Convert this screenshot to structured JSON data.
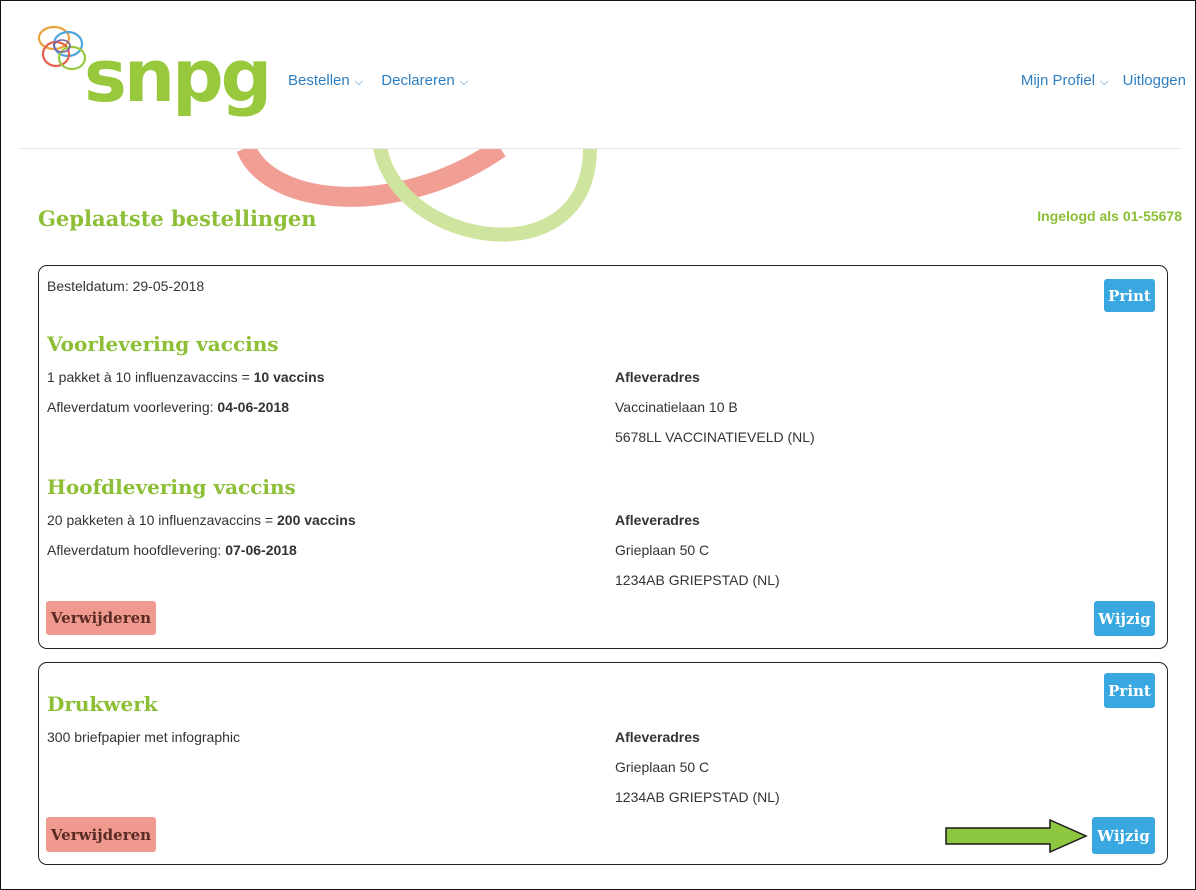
{
  "brand": {
    "logo_text": "snpg",
    "green": "#98c93c",
    "blue": "#3aa8e0",
    "red": "#f09a8f"
  },
  "nav": {
    "left": [
      {
        "label": "Bestellen"
      },
      {
        "label": "Declareren"
      }
    ],
    "right": [
      {
        "label": "Mijn Profiel"
      },
      {
        "label": "Uitloggen"
      }
    ]
  },
  "page": {
    "title": "Geplaatste bestellingen",
    "logged_in": "Ingelogd als 01-55678"
  },
  "order1": {
    "date_label": "Besteldatum: 29-05-2018",
    "print_label": "Print",
    "pre": {
      "title": "Voorlevering vaccins",
      "qty_prefix": "1 pakket à 10 influenzavaccins = ",
      "qty_bold": "10 vaccins",
      "date_prefix": "Afleverdatum voorlevering: ",
      "date_bold": "04-06-2018",
      "address_label": "Afleveradres",
      "address_line1": "Vaccinatielaan 10 B",
      "address_line2": "5678LL VACCINATIEVELD (NL)"
    },
    "main": {
      "title": "Hoofdlevering vaccins",
      "qty_prefix": "20 pakketen à 10 influenzavaccins = ",
      "qty_bold": "200 vaccins",
      "date_prefix": "Afleverdatum hoofdlevering: ",
      "date_bold": "07-06-2018",
      "address_label": "Afleveradres",
      "address_line1": "Grieplaan 50 C",
      "address_line2": "1234AB GRIEPSTAD (NL)"
    },
    "delete_label": "Verwijderen",
    "edit_label": "Wijzig"
  },
  "order2": {
    "print_label": "Print",
    "title": "Drukwerk",
    "item": "300 briefpapier met infographic",
    "address_label": "Afleveradres",
    "address_line1": "Grieplaan 50 C",
    "address_line2": "1234AB GRIEPSTAD (NL)",
    "delete_label": "Verwijderen",
    "edit_label": "Wijzig"
  }
}
